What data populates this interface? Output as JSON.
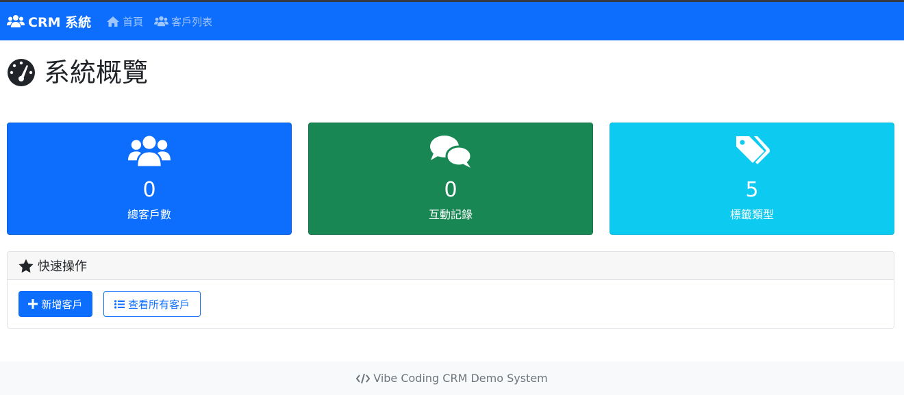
{
  "navbar": {
    "brand": "CRM 系統",
    "brand_icon": "users-icon",
    "links": [
      {
        "label": "首頁",
        "icon": "home-icon"
      },
      {
        "label": "客戶列表",
        "icon": "users-icon"
      }
    ],
    "color": "#0d6efd"
  },
  "page": {
    "title": "系統概覽",
    "title_icon": "dashboard-gauge-icon"
  },
  "stats": [
    {
      "value": "0",
      "label": "總客戶數",
      "icon": "users-icon",
      "color": "#0d6efd"
    },
    {
      "value": "0",
      "label": "互動記錄",
      "icon": "comments-icon",
      "color": "#198754"
    },
    {
      "value": "5",
      "label": "標籤類型",
      "icon": "tags-icon",
      "color": "#0dcaf0"
    }
  ],
  "quick_actions": {
    "title": "快速操作",
    "title_icon": "star-icon",
    "add_customer": "新增客戶",
    "view_all": "查看所有客戶"
  },
  "footer": {
    "text": "Vibe Coding CRM Demo System",
    "icon": "code-icon"
  }
}
